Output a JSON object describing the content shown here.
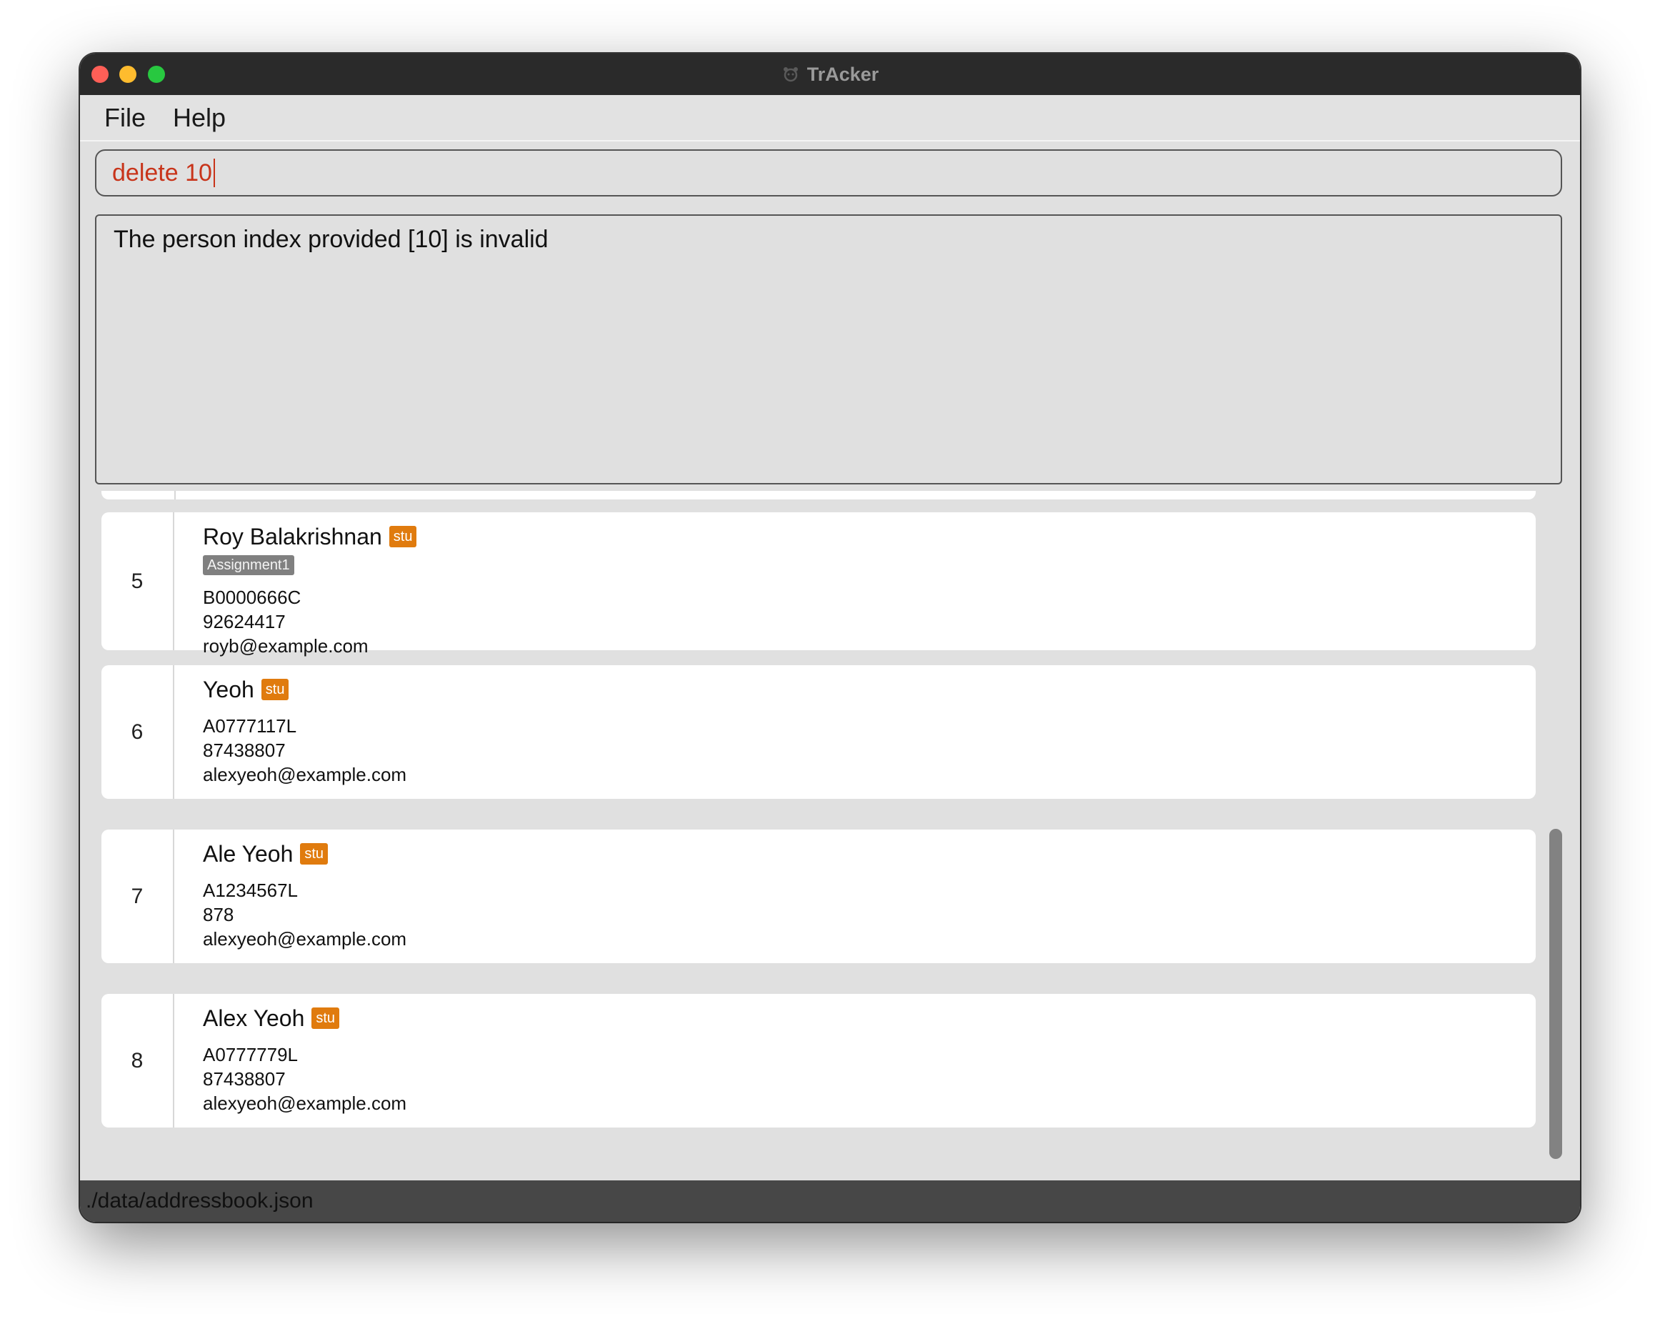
{
  "window": {
    "title": "TrAcker"
  },
  "menu": {
    "items": [
      {
        "label": "File"
      },
      {
        "label": "Help"
      }
    ]
  },
  "command": {
    "value": "delete 10"
  },
  "result": {
    "message": "The person index provided [10] is invalid"
  },
  "persons": [
    {
      "index": "5",
      "name": "Roy Balakrishnan",
      "role": "stu",
      "tags": [
        "Assignment1"
      ],
      "id": "B0000666C",
      "phone": "92624417",
      "email": "royb@example.com"
    },
    {
      "index": "6",
      "name": "Yeoh",
      "role": "stu",
      "tags": [],
      "id": "A0777117L",
      "phone": "87438807",
      "email": "alexyeoh@example.com"
    },
    {
      "index": "7",
      "name": "Ale Yeoh",
      "role": "stu",
      "tags": [],
      "id": "A1234567L",
      "phone": "878",
      "email": "alexyeoh@example.com"
    },
    {
      "index": "8",
      "name": "Alex Yeoh",
      "role": "stu",
      "tags": [],
      "id": "A0777779L",
      "phone": "87438807",
      "email": "alexyeoh@example.com"
    }
  ],
  "status": {
    "file_path": "./data/addressbook.json"
  },
  "colors": {
    "role_tag": "#e07b0e",
    "assignment_tag": "#808080",
    "command_text": "#c8341a",
    "titlebar": "#2a2a2a",
    "statusbar": "#474747"
  }
}
